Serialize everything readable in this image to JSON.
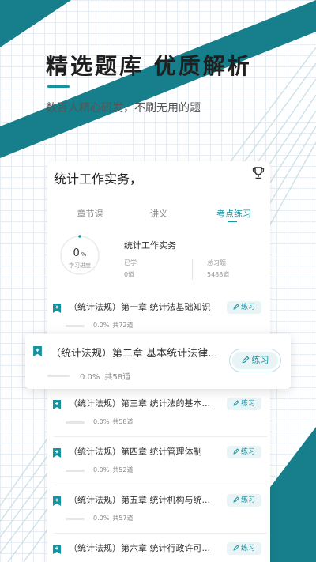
{
  "hero": {
    "headline": "精选题库  优质解析",
    "subhead": "数百人精心研发，不刷无用的题"
  },
  "card": {
    "title": "统计工作实务，",
    "tabs": [
      {
        "label": "章节课",
        "active": false
      },
      {
        "label": "讲义",
        "active": false
      },
      {
        "label": "考点练习",
        "active": true
      }
    ],
    "progress": {
      "percent": 0,
      "percent_text": "0",
      "percent_sign": "%",
      "label": "学习进度"
    },
    "subject_name": "统计工作实务",
    "learned_label": "已学",
    "learned_value": "0道",
    "total_label": "总习题",
    "total_value": "5488道"
  },
  "chapters": [
    {
      "title": "（统计法规）第一章 统计法基础知识",
      "progress": "0.0%",
      "count": "共72道",
      "button": "练习"
    },
    {
      "title": "（统计法规）第二章 基本统计法律...",
      "progress": "0.0%",
      "count": "共58道",
      "button": "练习"
    },
    {
      "title": "（统计法规）第三章 统计法的基本...",
      "progress": "0.0%",
      "count": "共58道",
      "button": "练习"
    },
    {
      "title": "（统计法规）第四章 统计管理体制",
      "progress": "0.0%",
      "count": "共52道",
      "button": "练习"
    },
    {
      "title": "（统计法规）第五章 统计机构与统...",
      "progress": "0.0%",
      "count": "共57道",
      "button": "练习"
    },
    {
      "title": "（统计法规）第六章 统计行政许可...",
      "progress": "",
      "count": "",
      "button": "练习"
    }
  ],
  "icons": {
    "trophy": "trophy-icon",
    "bookmark": "bookmark-icon",
    "edit": "edit-icon"
  },
  "colors": {
    "accent": "#1593a0",
    "accent_light": "#e8f4f6",
    "dark_teal": "#0f7f8c"
  }
}
